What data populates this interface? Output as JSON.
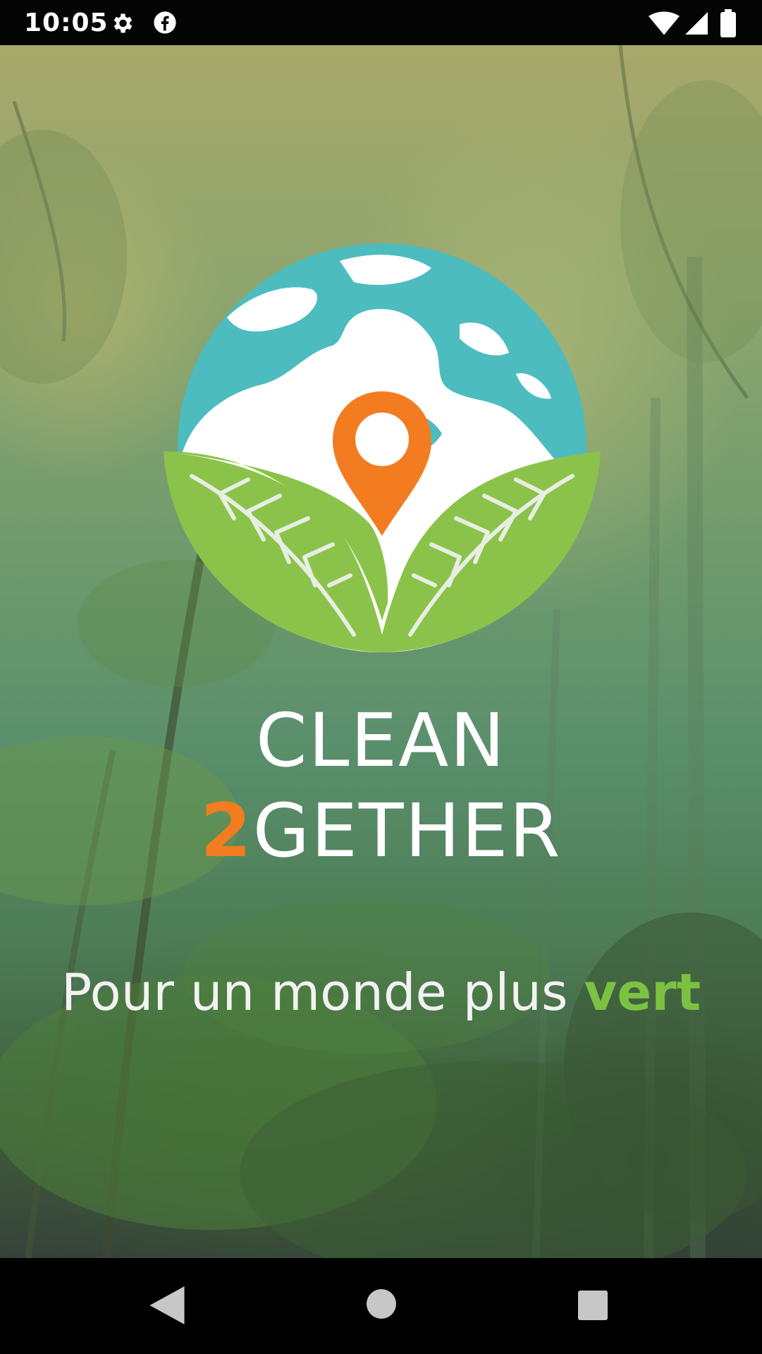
{
  "status_bar": {
    "time": "10:05",
    "icons": [
      "gear-icon",
      "facebook-icon",
      "wifi-icon",
      "signal-icon",
      "battery-icon"
    ]
  },
  "brand": {
    "line1": "CLEAN",
    "line2_number": "2",
    "line2_rest": "GETHER"
  },
  "tagline": {
    "text": "Pour un monde plus ",
    "accent": "vert"
  },
  "colors": {
    "accent_orange": "#f37c20",
    "accent_green": "#7cc242",
    "globe_teal": "#4dbcbf",
    "leaf_green": "#8bc34a"
  },
  "nav_bar": {
    "icons": [
      "back-icon",
      "home-icon",
      "recents-icon"
    ]
  }
}
